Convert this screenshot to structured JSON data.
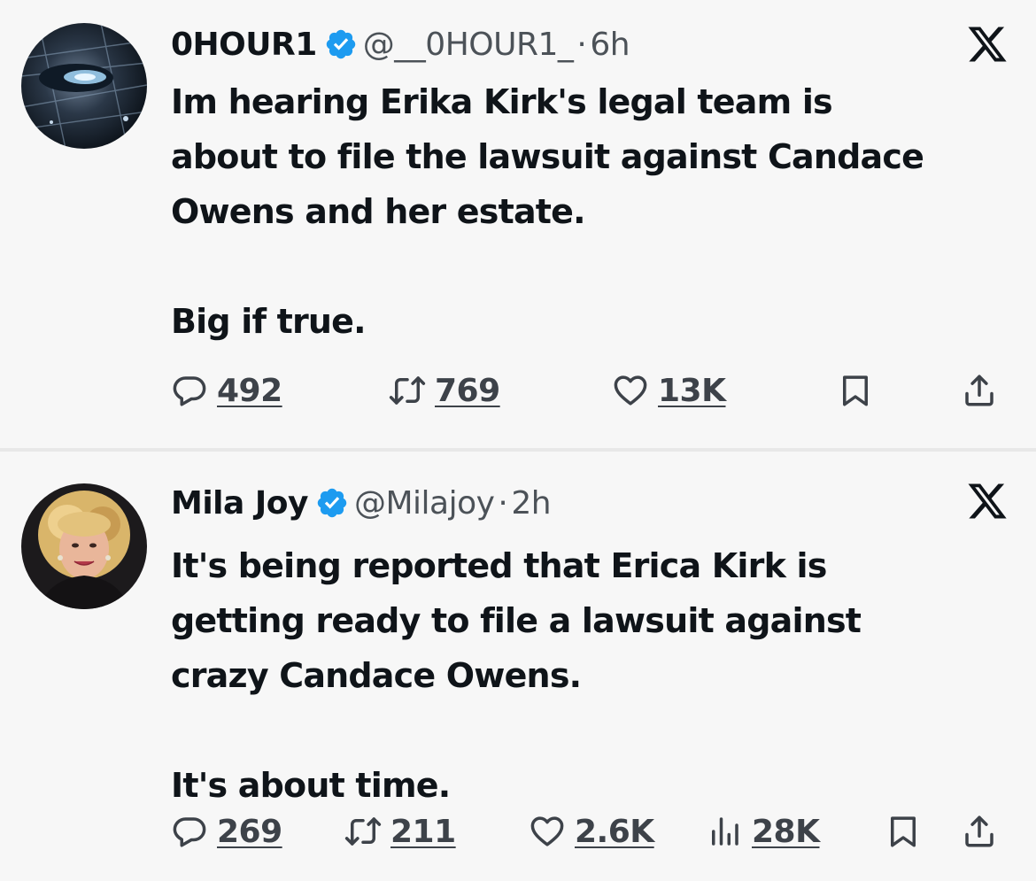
{
  "colors": {
    "verified": "#1d9bf0",
    "icon": "#3d4249",
    "text": "#0f1419",
    "muted": "#4c5258"
  },
  "tweets": [
    {
      "name": "0HOUR1",
      "handle": "@__0HOUR1_",
      "separator": "·",
      "time": "6h",
      "lines": [
        "Im hearing Erika Kirk's legal team is",
        "about to file the lawsuit against Candace",
        "Owens and her estate."
      ],
      "lines2": [
        "Big if true."
      ],
      "replies": "492",
      "reposts": "769",
      "likes": "13K"
    },
    {
      "name": "Mila Joy",
      "handle": "@Milajoy",
      "separator": "·",
      "time": "2h",
      "lines": [
        "It's being reported that Erica Kirk is",
        "getting ready to file a lawsuit against",
        "crazy Candace Owens."
      ],
      "lines2": [
        "It's about time."
      ],
      "replies": "269",
      "reposts": "211",
      "likes": "2.6K",
      "views": "28K"
    }
  ],
  "icons": {
    "verified": "verified-badge-icon",
    "close": "x-logo-icon",
    "reply": "reply-icon",
    "repost": "repost-icon",
    "like": "heart-icon",
    "views": "views-icon",
    "bookmark": "bookmark-icon",
    "share": "share-icon"
  }
}
